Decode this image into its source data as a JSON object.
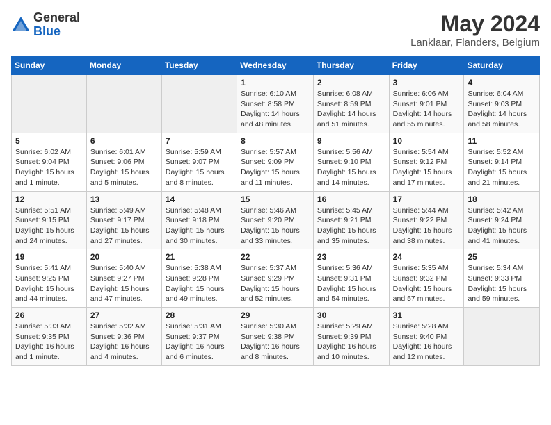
{
  "logo": {
    "general": "General",
    "blue": "Blue"
  },
  "title": "May 2024",
  "subtitle": "Lanklaar, Flanders, Belgium",
  "days_of_week": [
    "Sunday",
    "Monday",
    "Tuesday",
    "Wednesday",
    "Thursday",
    "Friday",
    "Saturday"
  ],
  "weeks": [
    [
      {
        "day": "",
        "sunrise": "",
        "sunset": "",
        "daylight": ""
      },
      {
        "day": "",
        "sunrise": "",
        "sunset": "",
        "daylight": ""
      },
      {
        "day": "",
        "sunrise": "",
        "sunset": "",
        "daylight": ""
      },
      {
        "day": "1",
        "sunrise": "Sunrise: 6:10 AM",
        "sunset": "Sunset: 8:58 PM",
        "daylight": "Daylight: 14 hours and 48 minutes."
      },
      {
        "day": "2",
        "sunrise": "Sunrise: 6:08 AM",
        "sunset": "Sunset: 8:59 PM",
        "daylight": "Daylight: 14 hours and 51 minutes."
      },
      {
        "day": "3",
        "sunrise": "Sunrise: 6:06 AM",
        "sunset": "Sunset: 9:01 PM",
        "daylight": "Daylight: 14 hours and 55 minutes."
      },
      {
        "day": "4",
        "sunrise": "Sunrise: 6:04 AM",
        "sunset": "Sunset: 9:03 PM",
        "daylight": "Daylight: 14 hours and 58 minutes."
      }
    ],
    [
      {
        "day": "5",
        "sunrise": "Sunrise: 6:02 AM",
        "sunset": "Sunset: 9:04 PM",
        "daylight": "Daylight: 15 hours and 1 minute."
      },
      {
        "day": "6",
        "sunrise": "Sunrise: 6:01 AM",
        "sunset": "Sunset: 9:06 PM",
        "daylight": "Daylight: 15 hours and 5 minutes."
      },
      {
        "day": "7",
        "sunrise": "Sunrise: 5:59 AM",
        "sunset": "Sunset: 9:07 PM",
        "daylight": "Daylight: 15 hours and 8 minutes."
      },
      {
        "day": "8",
        "sunrise": "Sunrise: 5:57 AM",
        "sunset": "Sunset: 9:09 PM",
        "daylight": "Daylight: 15 hours and 11 minutes."
      },
      {
        "day": "9",
        "sunrise": "Sunrise: 5:56 AM",
        "sunset": "Sunset: 9:10 PM",
        "daylight": "Daylight: 15 hours and 14 minutes."
      },
      {
        "day": "10",
        "sunrise": "Sunrise: 5:54 AM",
        "sunset": "Sunset: 9:12 PM",
        "daylight": "Daylight: 15 hours and 17 minutes."
      },
      {
        "day": "11",
        "sunrise": "Sunrise: 5:52 AM",
        "sunset": "Sunset: 9:14 PM",
        "daylight": "Daylight: 15 hours and 21 minutes."
      }
    ],
    [
      {
        "day": "12",
        "sunrise": "Sunrise: 5:51 AM",
        "sunset": "Sunset: 9:15 PM",
        "daylight": "Daylight: 15 hours and 24 minutes."
      },
      {
        "day": "13",
        "sunrise": "Sunrise: 5:49 AM",
        "sunset": "Sunset: 9:17 PM",
        "daylight": "Daylight: 15 hours and 27 minutes."
      },
      {
        "day": "14",
        "sunrise": "Sunrise: 5:48 AM",
        "sunset": "Sunset: 9:18 PM",
        "daylight": "Daylight: 15 hours and 30 minutes."
      },
      {
        "day": "15",
        "sunrise": "Sunrise: 5:46 AM",
        "sunset": "Sunset: 9:20 PM",
        "daylight": "Daylight: 15 hours and 33 minutes."
      },
      {
        "day": "16",
        "sunrise": "Sunrise: 5:45 AM",
        "sunset": "Sunset: 9:21 PM",
        "daylight": "Daylight: 15 hours and 35 minutes."
      },
      {
        "day": "17",
        "sunrise": "Sunrise: 5:44 AM",
        "sunset": "Sunset: 9:22 PM",
        "daylight": "Daylight: 15 hours and 38 minutes."
      },
      {
        "day": "18",
        "sunrise": "Sunrise: 5:42 AM",
        "sunset": "Sunset: 9:24 PM",
        "daylight": "Daylight: 15 hours and 41 minutes."
      }
    ],
    [
      {
        "day": "19",
        "sunrise": "Sunrise: 5:41 AM",
        "sunset": "Sunset: 9:25 PM",
        "daylight": "Daylight: 15 hours and 44 minutes."
      },
      {
        "day": "20",
        "sunrise": "Sunrise: 5:40 AM",
        "sunset": "Sunset: 9:27 PM",
        "daylight": "Daylight: 15 hours and 47 minutes."
      },
      {
        "day": "21",
        "sunrise": "Sunrise: 5:38 AM",
        "sunset": "Sunset: 9:28 PM",
        "daylight": "Daylight: 15 hours and 49 minutes."
      },
      {
        "day": "22",
        "sunrise": "Sunrise: 5:37 AM",
        "sunset": "Sunset: 9:29 PM",
        "daylight": "Daylight: 15 hours and 52 minutes."
      },
      {
        "day": "23",
        "sunrise": "Sunrise: 5:36 AM",
        "sunset": "Sunset: 9:31 PM",
        "daylight": "Daylight: 15 hours and 54 minutes."
      },
      {
        "day": "24",
        "sunrise": "Sunrise: 5:35 AM",
        "sunset": "Sunset: 9:32 PM",
        "daylight": "Daylight: 15 hours and 57 minutes."
      },
      {
        "day": "25",
        "sunrise": "Sunrise: 5:34 AM",
        "sunset": "Sunset: 9:33 PM",
        "daylight": "Daylight: 15 hours and 59 minutes."
      }
    ],
    [
      {
        "day": "26",
        "sunrise": "Sunrise: 5:33 AM",
        "sunset": "Sunset: 9:35 PM",
        "daylight": "Daylight: 16 hours and 1 minute."
      },
      {
        "day": "27",
        "sunrise": "Sunrise: 5:32 AM",
        "sunset": "Sunset: 9:36 PM",
        "daylight": "Daylight: 16 hours and 4 minutes."
      },
      {
        "day": "28",
        "sunrise": "Sunrise: 5:31 AM",
        "sunset": "Sunset: 9:37 PM",
        "daylight": "Daylight: 16 hours and 6 minutes."
      },
      {
        "day": "29",
        "sunrise": "Sunrise: 5:30 AM",
        "sunset": "Sunset: 9:38 PM",
        "daylight": "Daylight: 16 hours and 8 minutes."
      },
      {
        "day": "30",
        "sunrise": "Sunrise: 5:29 AM",
        "sunset": "Sunset: 9:39 PM",
        "daylight": "Daylight: 16 hours and 10 minutes."
      },
      {
        "day": "31",
        "sunrise": "Sunrise: 5:28 AM",
        "sunset": "Sunset: 9:40 PM",
        "daylight": "Daylight: 16 hours and 12 minutes."
      },
      {
        "day": "",
        "sunrise": "",
        "sunset": "",
        "daylight": ""
      }
    ]
  ]
}
